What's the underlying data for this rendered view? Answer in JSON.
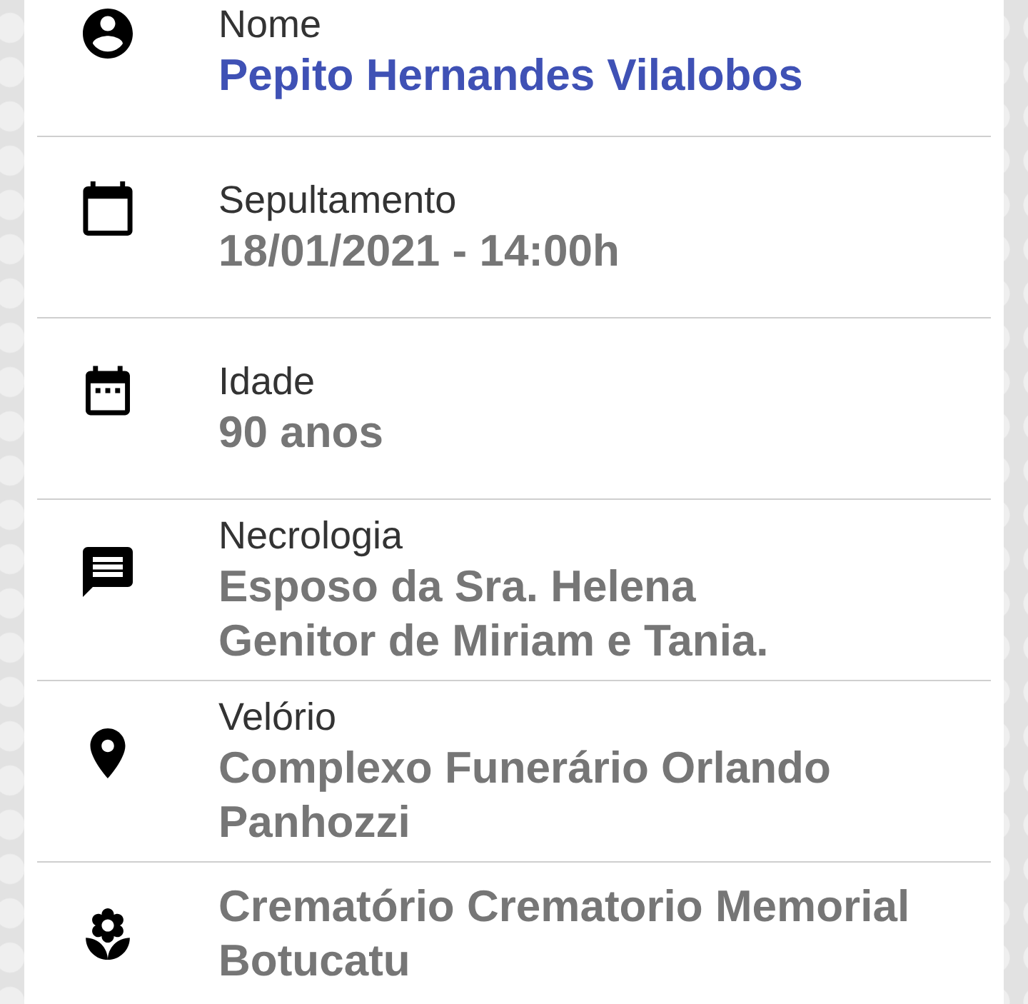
{
  "rows": [
    {
      "label": "Nome",
      "value_lines": [
        "Pepito Hernandes Vilalobos"
      ],
      "highlighted": true
    },
    {
      "label": "Sepultamento",
      "value_lines": [
        "18/01/2021 - 14:00h"
      ],
      "highlighted": false
    },
    {
      "label": "Idade",
      "value_lines": [
        "90 anos"
      ],
      "highlighted": false
    },
    {
      "label": "Necrologia",
      "value_lines": [
        "Esposo da Sra. Helena",
        "Genitor de Miriam e Tania."
      ],
      "highlighted": false
    },
    {
      "label": "Velório",
      "value_lines": [
        "Complexo Funerário Orlando",
        "Panhozzi"
      ],
      "highlighted": false
    },
    {
      "value_lines": [
        "Crematório Crematorio Memorial",
        "Botucatu"
      ],
      "highlighted": false
    }
  ]
}
